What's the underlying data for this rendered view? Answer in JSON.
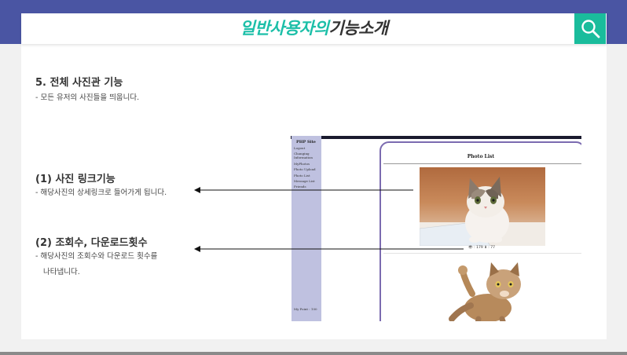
{
  "header": {
    "title_accent": "일반사용자의",
    "title_rest": "기능소개",
    "search_icon": "search-icon"
  },
  "section": {
    "heading": "5. 전체 사진관 기능",
    "desc": "-  모든 유저의 사진들을 띄웁니다."
  },
  "features": [
    {
      "heading": "(1) 사진 링크기능",
      "desc": "-  해당사진의 상세링크로 들어가게 됩니다."
    },
    {
      "heading": "(2) 조회수, 다운로드횟수",
      "desc_line1": "-  해당사진의 조회수와 다운로드 횟수를",
      "desc_line2": "나타냅니다."
    }
  ],
  "screenshot": {
    "site_title": "PHP Site",
    "menu": [
      "Logout",
      "Changing Information",
      "MyPhotos",
      "Photo Upload",
      "Photo List",
      "Message List",
      "Friends"
    ],
    "point": "My Point : 100",
    "panel_title": "Photo List",
    "stats": "👁 : 179    ⬇ : 77"
  },
  "colors": {
    "band": "#4a55a3",
    "accent": "#1cbfa8",
    "search_bg": "#1abc9c"
  }
}
